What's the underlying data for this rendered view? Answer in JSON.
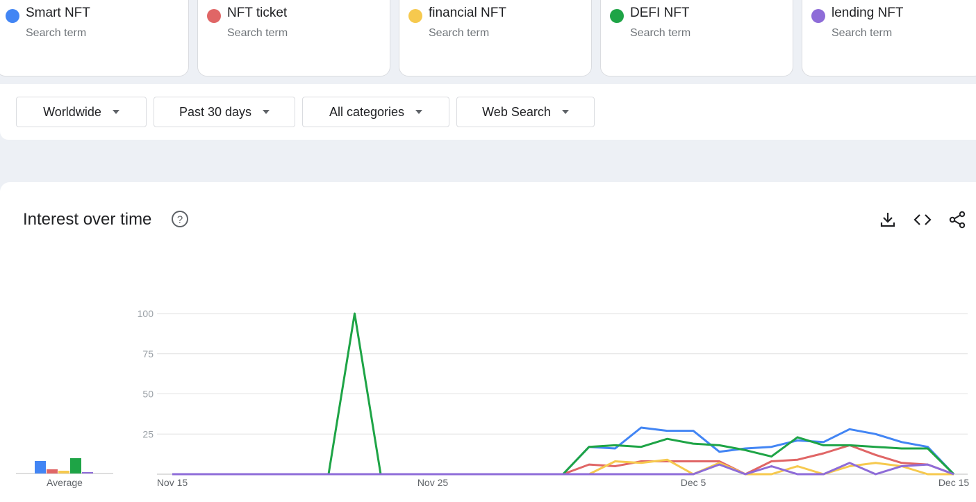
{
  "terms": [
    {
      "name": "Smart NFT",
      "sub": "Search term",
      "color": "#4285f4"
    },
    {
      "name": "NFT ticket",
      "sub": "Search term",
      "color": "#e06666"
    },
    {
      "name": "financial NFT",
      "sub": "Search term",
      "color": "#f6c94e"
    },
    {
      "name": "DEFI NFT",
      "sub": "Search term",
      "color": "#1ea446"
    },
    {
      "name": "lending NFT",
      "sub": "Search term",
      "color": "#8e6cd8"
    }
  ],
  "filters": {
    "region": "Worldwide",
    "time": "Past 30 days",
    "category": "All categories",
    "search_type": "Web Search"
  },
  "panel": {
    "title": "Interest over time",
    "icons": [
      "help-icon",
      "download-icon",
      "embed-icon",
      "share-icon"
    ]
  },
  "average_label": "Average",
  "chart_data": {
    "type": "line",
    "ylim": [
      0,
      100
    ],
    "yticks": [
      "100",
      "75",
      "50",
      "25"
    ],
    "x": [
      "Nov 15",
      "Nov 16",
      "Nov 17",
      "Nov 18",
      "Nov 19",
      "Nov 20",
      "Nov 21",
      "Nov 22",
      "Nov 23",
      "Nov 24",
      "Nov 25",
      "Nov 26",
      "Nov 27",
      "Nov 28",
      "Nov 29",
      "Nov 30",
      "Dec 1",
      "Dec 2",
      "Dec 3",
      "Dec 4",
      "Dec 5",
      "Dec 6",
      "Dec 7",
      "Dec 8",
      "Dec 9",
      "Dec 10",
      "Dec 11",
      "Dec 12",
      "Dec 13",
      "Dec 14",
      "Dec 15"
    ],
    "xtick_labels": [
      "Nov 15",
      "Nov 25",
      "Dec 5",
      "Dec 15"
    ],
    "series": [
      {
        "name": "Smart NFT",
        "color": "#4285f4",
        "values": [
          0,
          0,
          0,
          0,
          0,
          0,
          0,
          0,
          0,
          0,
          0,
          0,
          0,
          0,
          0,
          0,
          17,
          16,
          29,
          27,
          27,
          14,
          16,
          17,
          21,
          20,
          28,
          25,
          20,
          17,
          0
        ]
      },
      {
        "name": "NFT ticket",
        "color": "#e06666",
        "values": [
          0,
          0,
          0,
          0,
          0,
          0,
          0,
          0,
          0,
          0,
          0,
          0,
          0,
          0,
          0,
          0,
          6,
          5,
          8,
          8,
          8,
          8,
          0,
          8,
          9,
          13,
          18,
          12,
          7,
          6,
          0
        ]
      },
      {
        "name": "financial NFT",
        "color": "#f6c94e",
        "values": [
          0,
          0,
          0,
          0,
          0,
          0,
          0,
          0,
          0,
          0,
          0,
          0,
          0,
          0,
          0,
          0,
          0,
          8,
          7,
          9,
          0,
          7,
          0,
          0,
          5,
          0,
          5,
          7,
          5,
          0,
          0
        ]
      },
      {
        "name": "DEFI NFT",
        "color": "#1ea446",
        "values": [
          0,
          0,
          0,
          0,
          0,
          0,
          0,
          100,
          0,
          0,
          0,
          0,
          0,
          0,
          0,
          0,
          17,
          18,
          17,
          22,
          19,
          18,
          15,
          11,
          23,
          18,
          18,
          17,
          16,
          16,
          0
        ]
      },
      {
        "name": "lending NFT",
        "color": "#8e6cd8",
        "values": [
          0,
          0,
          0,
          0,
          0,
          0,
          0,
          0,
          0,
          0,
          0,
          0,
          0,
          0,
          0,
          0,
          0,
          0,
          0,
          0,
          0,
          6,
          0,
          5,
          0,
          0,
          7,
          0,
          5,
          6,
          0
        ]
      }
    ],
    "averages": [
      {
        "name": "Smart NFT",
        "color": "#4285f4",
        "value": 9
      },
      {
        "name": "NFT ticket",
        "color": "#e06666",
        "value": 3
      },
      {
        "name": "financial NFT",
        "color": "#f6c94e",
        "value": 2
      },
      {
        "name": "DEFI NFT",
        "color": "#1ea446",
        "value": 11
      },
      {
        "name": "lending NFT",
        "color": "#8e6cd8",
        "value": 1
      }
    ]
  }
}
